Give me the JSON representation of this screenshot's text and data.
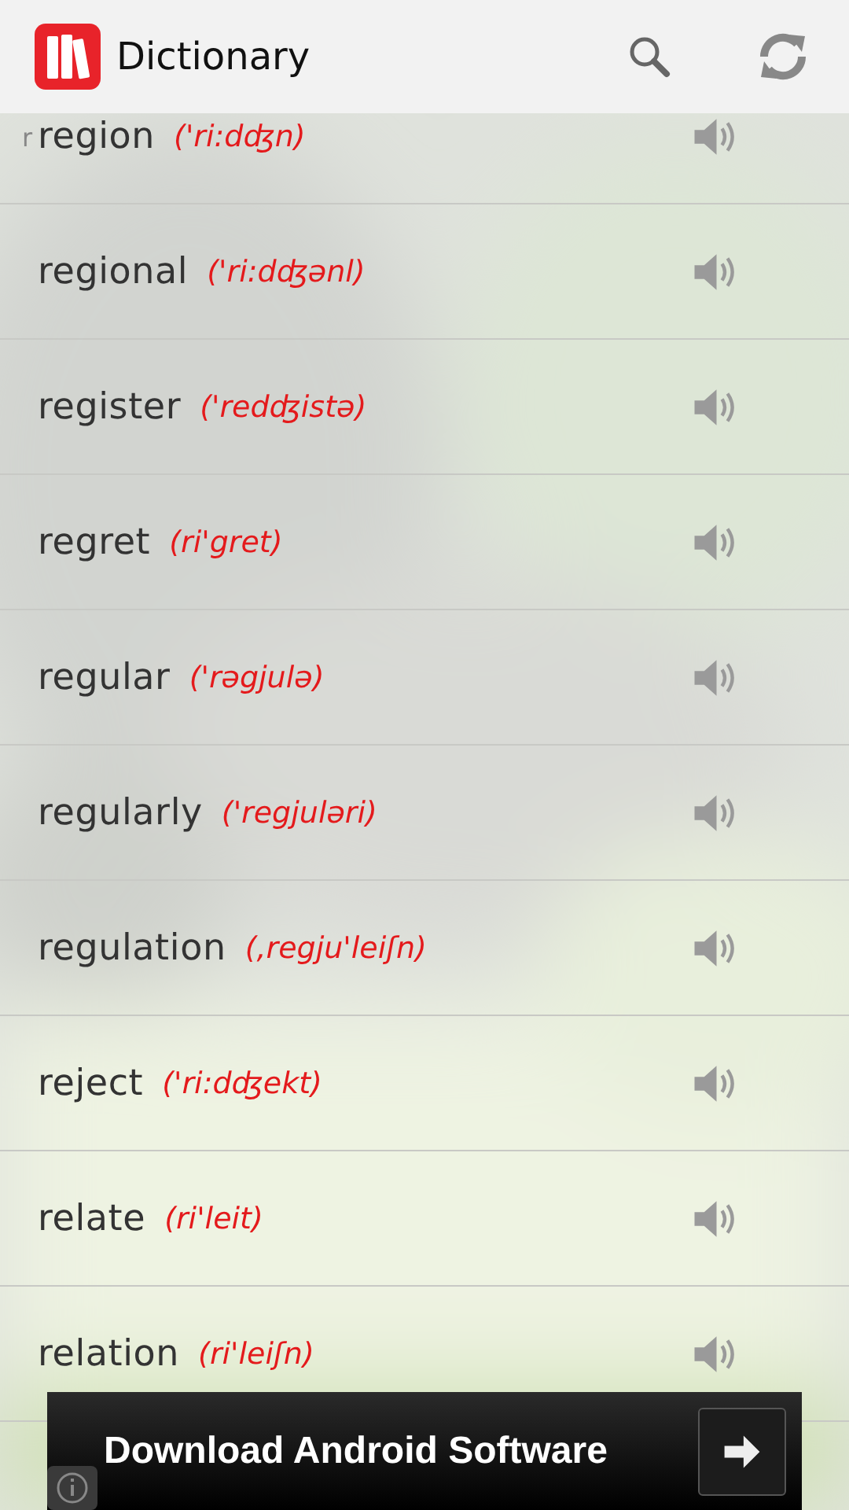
{
  "action_bar": {
    "title": "Dictionary"
  },
  "index_letter": "r",
  "words": [
    {
      "word": "region",
      "phonetic": "('ri:dʤn)"
    },
    {
      "word": "regional",
      "phonetic": "('ri:dʤənl)"
    },
    {
      "word": "register",
      "phonetic": "('redʤistə)"
    },
    {
      "word": "regret",
      "phonetic": "(ri'gret)"
    },
    {
      "word": "regular",
      "phonetic": "('rəgjulə)"
    },
    {
      "word": "regularly",
      "phonetic": "('regjuləri)"
    },
    {
      "word": "regulation",
      "phonetic": "(,regju'leiʃn)"
    },
    {
      "word": "reject",
      "phonetic": "('ri:dʤekt)"
    },
    {
      "word": "relate",
      "phonetic": "(ri'leit)"
    },
    {
      "word": "relation",
      "phonetic": "(ri'leiʃn)"
    }
  ],
  "ad": {
    "text": "Download Android Software"
  }
}
